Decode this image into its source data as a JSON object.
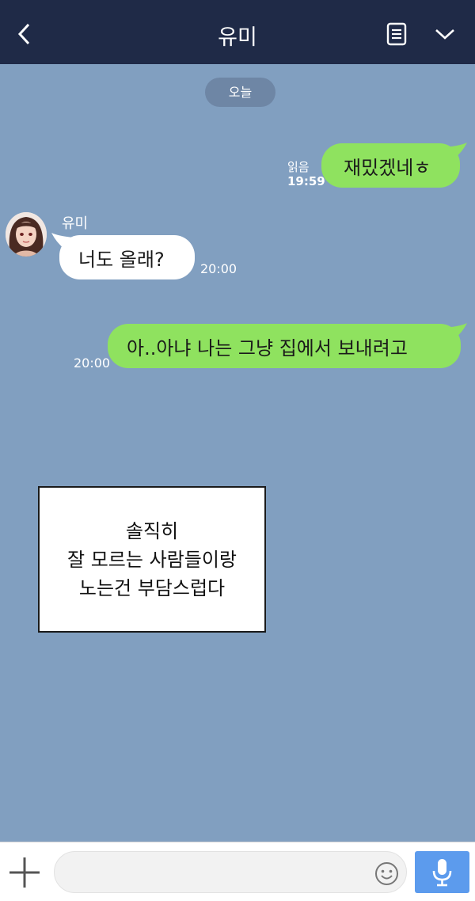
{
  "header": {
    "title": "유미"
  },
  "date_separator": "오늘",
  "messages": [
    {
      "from": "me",
      "text": "재밌겠네ㅎ",
      "read": "읽음",
      "time": "19:59"
    },
    {
      "from": "other",
      "sender": "유미",
      "text": "너도 올래?",
      "time": "20:00"
    },
    {
      "from": "me",
      "text": "아..아냐 나는 그냥 집에서 보내려고",
      "time": "20:00"
    }
  ],
  "caption": {
    "lines": [
      "솔직히",
      "잘 모르는 사람들이랑",
      " 노는건 부담스럽다"
    ]
  },
  "composer": {
    "placeholder": ""
  },
  "colors": {
    "header": "#1f2a47",
    "background": "#819fc0",
    "my_bubble": "#8fe25f",
    "mic_button": "#5c9bed"
  },
  "icons": [
    "back-arrow-icon",
    "note-icon",
    "chevron-down-icon",
    "plus-icon",
    "emoji-icon",
    "mic-icon"
  ]
}
